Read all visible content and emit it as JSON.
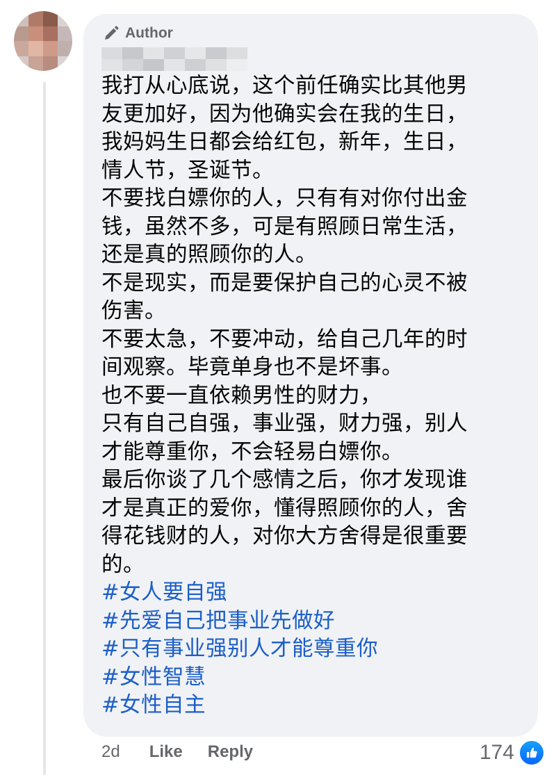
{
  "comment": {
    "badge_label": "Author",
    "body_lines": [
      "我打从心底说，这个前任确实比其他男",
      "友更加好，因为他确实会在我的生日，",
      "我妈妈生日都会给红包，新年，生日，",
      "情人节，圣诞节。",
      "不要找白嫖你的人，只有有对你付出金",
      "钱，虽然不多，可是有照顾日常生活，",
      "还是真的照顾你的人。",
      "不是现实，而是要保护自己的心灵不被",
      "伤害。",
      "不要太急，不要冲动，给自己几年的时",
      "间观察。毕竟单身也不是坏事。",
      "也不要一直依赖男性的财力，",
      "只有自己自强，事业强，财力强，别人",
      "才能尊重你，不会轻易白嫖你。",
      "最后你谈了几个感情之后，你才发现谁",
      "才是真正的爱你，懂得照顾你的人，舍",
      "得花钱财的人，对你大方舍得是很重要",
      "的。"
    ],
    "hashtags": [
      "#女人要自强",
      "#先爱自己把事业先做好",
      "#只有事业强别人才能尊重你",
      "#女性智慧",
      "#女性自主"
    ]
  },
  "footer": {
    "time": "2d",
    "like_label": "Like",
    "reply_label": "Reply",
    "reaction_count": "174"
  },
  "icons": {
    "badge_icon": "pen-icon",
    "reaction_icon": "like-thumb-icon"
  },
  "colors": {
    "bubble_bg": "#f0f2f5",
    "hashtag": "#1b5ec8",
    "secondary_text": "#65676b",
    "like_blue": "#0866ff"
  }
}
